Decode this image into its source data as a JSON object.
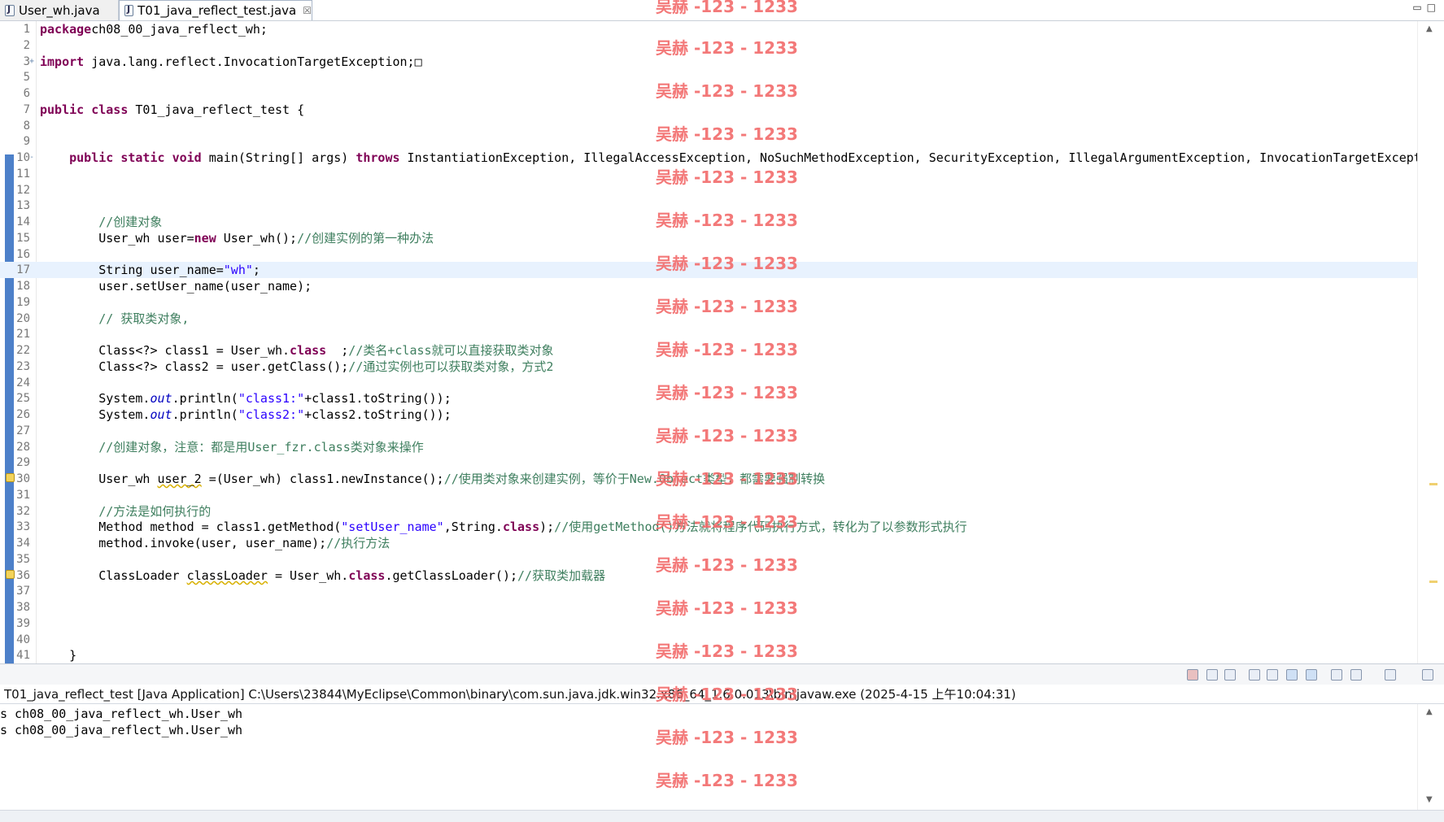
{
  "tabs": [
    {
      "label": "User_wh.java",
      "active": false
    },
    {
      "label": "T01_java_reflect_test.java",
      "active": true
    }
  ],
  "close_glyph": "☒",
  "editor": {
    "lines": [
      {
        "n": "1",
        "t": [
          [
            "kw",
            "package"
          ],
          [
            "",
            "ch08_00_java_reflect_wh;"
          ]
        ]
      },
      {
        "n": "2",
        "t": []
      },
      {
        "n": "3",
        "fold": "+",
        "t": [
          [
            "kw",
            "import"
          ],
          [
            "",
            " java.lang.reflect.InvocationTargetException;□"
          ]
        ]
      },
      {
        "n": "5",
        "t": []
      },
      {
        "n": "6",
        "t": []
      },
      {
        "n": "7",
        "t": [
          [
            "kw",
            "public"
          ],
          [
            "",
            " "
          ],
          [
            "kw",
            "class"
          ],
          [
            "",
            " T01_java_reflect_test {"
          ]
        ]
      },
      {
        "n": "8",
        "t": []
      },
      {
        "n": "9",
        "t": []
      },
      {
        "n": "10",
        "fold": "-",
        "t": [
          [
            "",
            "    "
          ],
          [
            "kw",
            "public"
          ],
          [
            "",
            " "
          ],
          [
            "kw",
            "static"
          ],
          [
            "",
            " "
          ],
          [
            "kw",
            "void"
          ],
          [
            "",
            " main(String[] args) "
          ],
          [
            "kw",
            "throws"
          ],
          [
            "",
            " InstantiationException, IllegalAccessException, NoSuchMethodException, SecurityException, IllegalArgumentException, InvocationTargetExcept"
          ]
        ]
      },
      {
        "n": "11",
        "t": []
      },
      {
        "n": "12",
        "t": []
      },
      {
        "n": "13",
        "t": []
      },
      {
        "n": "14",
        "t": [
          [
            "",
            "        "
          ],
          [
            "cm",
            "//创建对象"
          ]
        ]
      },
      {
        "n": "15",
        "t": [
          [
            "",
            "        User_wh user="
          ],
          [
            "kw",
            "new"
          ],
          [
            "",
            " User_wh();"
          ],
          [
            "cm",
            "//创建实例的第一种办法"
          ]
        ]
      },
      {
        "n": "16",
        "t": []
      },
      {
        "n": "17",
        "cur": true,
        "t": [
          [
            "",
            "        String user_name="
          ],
          [
            "str",
            "\"wh\""
          ],
          [
            "",
            ";"
          ]
        ]
      },
      {
        "n": "18",
        "t": [
          [
            "",
            "        user.setUser_name(user_name);"
          ]
        ]
      },
      {
        "n": "19",
        "t": []
      },
      {
        "n": "20",
        "t": [
          [
            "",
            "        "
          ],
          [
            "cm",
            "// 获取类对象,"
          ]
        ]
      },
      {
        "n": "21",
        "t": []
      },
      {
        "n": "22",
        "t": [
          [
            "",
            "        Class<?> class1 = User_wh."
          ],
          [
            "kw",
            "class"
          ],
          [
            "",
            "  ;"
          ],
          [
            "cm",
            "//类名+class就可以直接获取类对象"
          ]
        ]
      },
      {
        "n": "23",
        "t": [
          [
            "",
            "        Class<?> class2 = user.getClass();"
          ],
          [
            "cm",
            "//通过实例也可以获取类对象，方式2"
          ]
        ]
      },
      {
        "n": "24",
        "t": []
      },
      {
        "n": "25",
        "t": [
          [
            "",
            "        System."
          ],
          [
            "fld",
            "out"
          ],
          [
            "",
            ".println("
          ],
          [
            "str",
            "\"class1:\""
          ],
          [
            "",
            "+class1.toString());"
          ]
        ]
      },
      {
        "n": "26",
        "t": [
          [
            "",
            "        System."
          ],
          [
            "fld",
            "out"
          ],
          [
            "",
            ".println("
          ],
          [
            "str",
            "\"class2:\""
          ],
          [
            "",
            "+class2.toString());"
          ]
        ]
      },
      {
        "n": "27",
        "t": []
      },
      {
        "n": "28",
        "t": [
          [
            "",
            "        "
          ],
          [
            "cm",
            "//创建对象，注意：都是用User_fzr.class类对象来操作"
          ]
        ]
      },
      {
        "n": "29",
        "t": []
      },
      {
        "n": "30",
        "warn": true,
        "t": [
          [
            "",
            "        User_wh "
          ],
          [
            "wl",
            "user_2"
          ],
          [
            "",
            " =(User_wh) class1.newInstance();"
          ],
          [
            "cm",
            "//使用类对象来创建实例，等价于New.Object类型，都需要强制转换"
          ]
        ]
      },
      {
        "n": "31",
        "t": []
      },
      {
        "n": "32",
        "t": [
          [
            "",
            "        "
          ],
          [
            "cm",
            "//方法是如何执行的"
          ]
        ]
      },
      {
        "n": "33",
        "t": [
          [
            "",
            "        Method method = class1.getMethod("
          ],
          [
            "str",
            "\"setUser_name\""
          ],
          [
            "",
            ",String."
          ],
          [
            "kw",
            "class"
          ],
          [
            "",
            ");"
          ],
          [
            "cm",
            "//使用getMethod()方法就将程序代码执行方式，转化为了以参数形式执行"
          ]
        ]
      },
      {
        "n": "34",
        "t": [
          [
            "",
            "        method.invoke(user, user_name);"
          ],
          [
            "cm",
            "//执行方法"
          ]
        ]
      },
      {
        "n": "35",
        "t": []
      },
      {
        "n": "36",
        "warn": true,
        "t": [
          [
            "",
            "        ClassLoader "
          ],
          [
            "wl",
            "classLoader"
          ],
          [
            "",
            " = User_wh."
          ],
          [
            "kw",
            "class"
          ],
          [
            "",
            ".getClassLoader();"
          ],
          [
            "cm",
            "//获取类加载器"
          ]
        ]
      },
      {
        "n": "37",
        "t": []
      },
      {
        "n": "38",
        "t": []
      },
      {
        "n": "39",
        "t": []
      },
      {
        "n": "40",
        "t": []
      },
      {
        "n": "41",
        "t": [
          [
            "",
            "    }"
          ]
        ]
      }
    ]
  },
  "console": {
    "title": "T01_java_reflect_test [Java Application] C:\\Users\\23844\\MyEclipse\\Common\\binary\\com.sun.java.jdk.win32.x86_64_1.6.0.013\\bin\\javaw.exe (2025-4-15 上午10:04:31)",
    "output": [
      "s ch08_00_java_reflect_wh.User_wh",
      "s ch08_00_java_reflect_wh.User_wh"
    ]
  },
  "watermark": {
    "text": "吴赫 -123 - 1233"
  },
  "colors": {
    "keyword": "#7f0055",
    "string": "#2a00ff",
    "comment": "#3f7f5f",
    "watermark": "#f26b6b",
    "ruler": "#4d80c9"
  }
}
